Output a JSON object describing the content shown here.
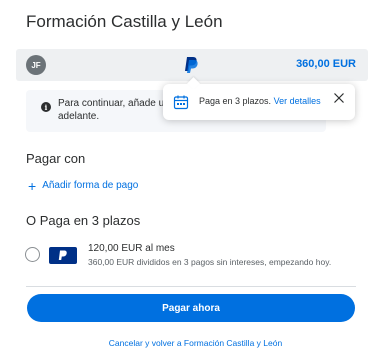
{
  "merchant": {
    "title": "Formación Castilla y León"
  },
  "account": {
    "avatar_initials": "JF",
    "amount": "360,00 EUR",
    "brand_color": "#0070e0"
  },
  "notice": {
    "text": "Para continuar, añade una adelante."
  },
  "popover": {
    "text": "Paga en 3 plazos.",
    "link": "Ver detalles"
  },
  "pay_with": {
    "label": "Pagar con",
    "add_payment": "Añadir forma de pago"
  },
  "pay_in_3": {
    "label": "O Paga en 3 plazos",
    "title": "120,00 EUR al mes",
    "subtitle": "360,00 EUR divididos en 3 pagos sin intereses, empezando hoy.",
    "selected": false
  },
  "actions": {
    "pay_now": "Pagar ahora",
    "cancel": "Cancelar y volver a Formación Castilla y León"
  }
}
